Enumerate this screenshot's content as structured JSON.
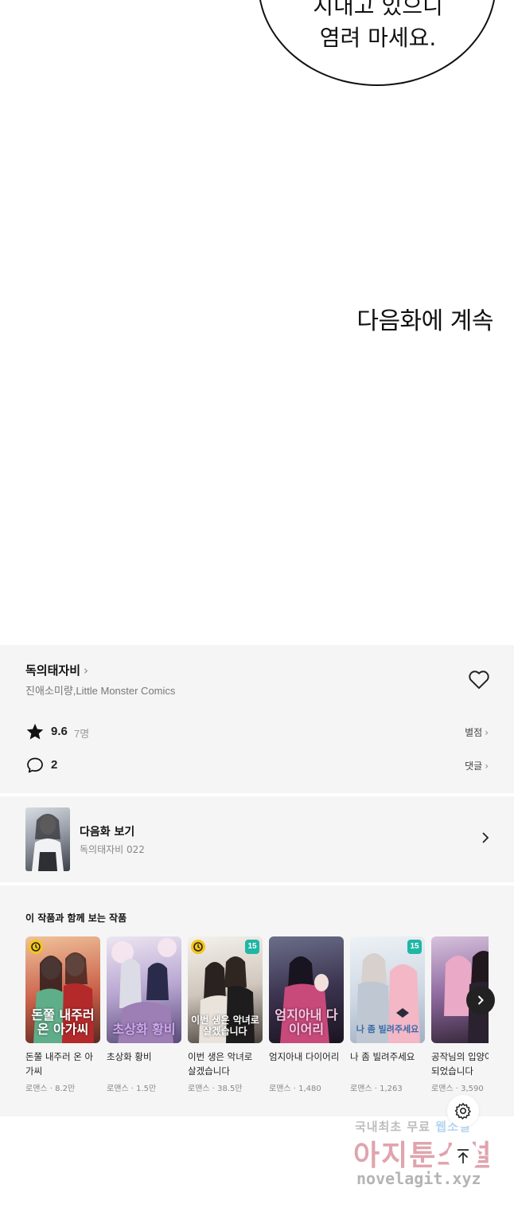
{
  "comic": {
    "bubble_line1": "지내고 있으니",
    "bubble_line2": "염려 마세요.",
    "continue": "다음화에 계속"
  },
  "series": {
    "title": "독의태자비",
    "authors": "진애소미량,Little Monster Comics",
    "rating": "9.6",
    "raters": "7명",
    "rating_link": "별점",
    "comments": "2",
    "comments_link": "댓글"
  },
  "next_episode": {
    "label": "다음화 보기",
    "subtitle": "독의태자비 022"
  },
  "recommendations": {
    "title": "이 작품과 함께 보는 작품",
    "items": [
      {
        "title": "돈쭐 내주러 온 아가씨",
        "meta": "로맨스 · 8.2만",
        "badge": "clock",
        "cover_text": "돈쭐 내주러 온 아가씨",
        "colors": [
          "#e9a07a",
          "#7a3b2e"
        ]
      },
      {
        "title": "초상화 황비",
        "meta": "로맨스 · 1.5만",
        "badge": "",
        "cover_text": "초상화 황비",
        "colors": [
          "#d6c8e6",
          "#6b5d8c"
        ]
      },
      {
        "title": "이번 생은 악녀로 살겠습니다",
        "meta": "로맨스 · 38.5만",
        "badge": "clock+15",
        "cover_text": "이번 생은 악녀로 살겠습니다",
        "colors": [
          "#e8e3dc",
          "#3a3431"
        ]
      },
      {
        "title": "엄지아내 다이어리",
        "meta": "로맨스 · 1,480",
        "badge": "",
        "cover_text": "엄지아내 다이어리",
        "colors": [
          "#9a8fb6",
          "#2a2238"
        ]
      },
      {
        "title": "나 좀 빌려주세요",
        "meta": "로맨스 · 1,263",
        "badge": "15",
        "cover_text": "나 좀 빌려주세요",
        "colors": [
          "#dbe4ef",
          "#f2b9c4"
        ]
      },
      {
        "title": "공작님의 입양아가 되었습니다",
        "meta": "로맨스 · 3,590",
        "badge": "",
        "cover_text": "",
        "colors": [
          "#b69ac6",
          "#3c2a40"
        ]
      }
    ]
  },
  "watermark": {
    "line1": "국내최초 무료",
    "line1_accent": "웹소설",
    "line2": "아지툰소설",
    "line3": "novelagit.xyz"
  },
  "colors": {
    "panel_bg": "#f5f5f5",
    "badge_15": "#1fb6a5",
    "badge_clock": "#f5c518"
  }
}
